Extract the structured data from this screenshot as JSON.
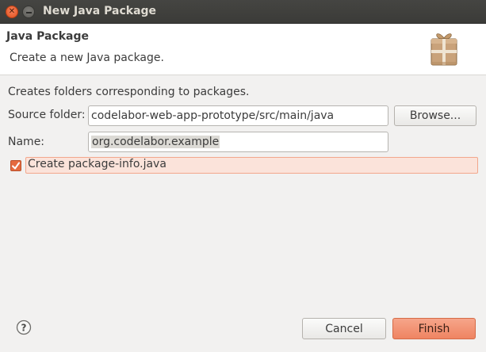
{
  "window": {
    "title": "New Java Package"
  },
  "header": {
    "title": "Java Package",
    "description": "Create a new Java package.",
    "icon": "package-icon"
  },
  "form": {
    "intro": "Creates folders corresponding to packages.",
    "source_folder_label": "Source folder:",
    "source_folder_value": "codelabor-web-app-prototype/src/main/java",
    "browse_label": "Browse...",
    "name_label": "Name:",
    "name_value": "org.codelabor.example",
    "package_info_label": "Create package-info.java",
    "package_info_checked": true
  },
  "footer": {
    "cancel_label": "Cancel",
    "finish_label": "Finish",
    "help_icon": "help-icon"
  },
  "colors": {
    "accent": "#ef8462",
    "titlebar": "#3c3b37",
    "window_bg": "#f2f1f0"
  }
}
